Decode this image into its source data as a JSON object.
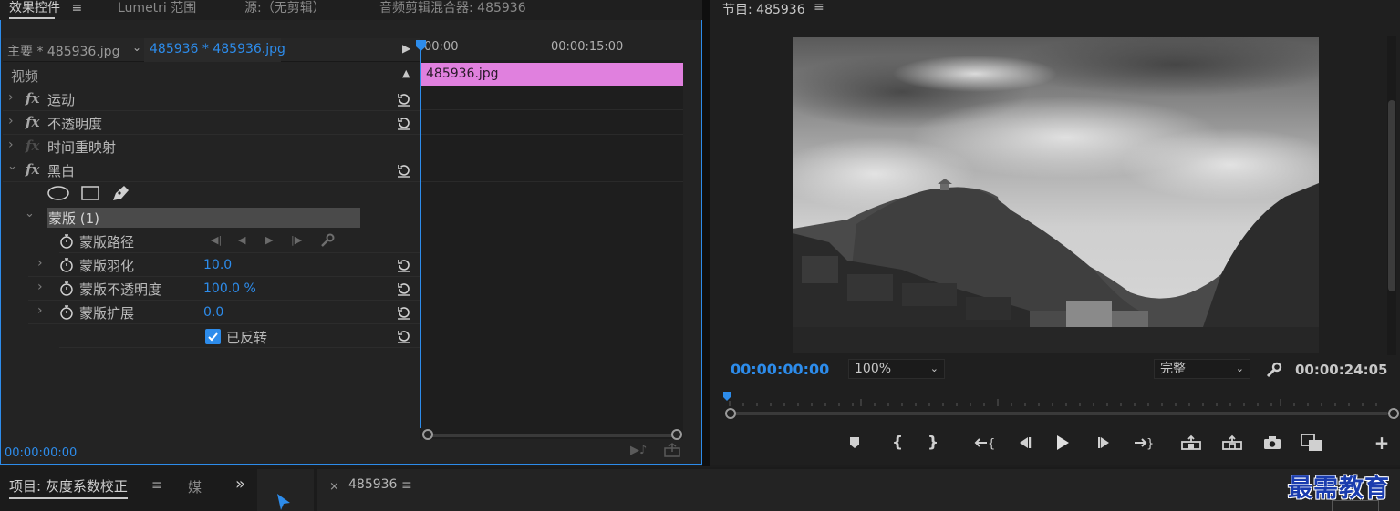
{
  "tabs_top": {
    "effect_controls": "效果控件",
    "lumetri": "Lumetri 范围",
    "source": "源:（无剪辑）",
    "audio_mixer": "音频剪辑混合器: 485936",
    "menu": "≡"
  },
  "effect_controls": {
    "master_clip": "主要 * 485936.jpg",
    "sequence_clip": "485936 * 485936.jpg",
    "section_video": "视频",
    "effects": [
      {
        "name": "运动",
        "enabled": true
      },
      {
        "name": "不透明度",
        "enabled": true
      },
      {
        "name": "时间重映射",
        "enabled": false
      },
      {
        "name": "黑白",
        "enabled": true
      }
    ],
    "mask": {
      "name": "蒙版 (1)",
      "path_label": "蒙版路径",
      "feather_label": "蒙版羽化",
      "feather_value": "10.0",
      "opacity_label": "蒙版不透明度",
      "opacity_value": "100.0 %",
      "expansion_label": "蒙版扩展",
      "expansion_value": "0.0",
      "inverted_label": "已反转",
      "inverted": true
    },
    "timeline": {
      "tick_start": "00:00",
      "tick_mid": "00:00:15:00",
      "clip_name": "485936.jpg"
    },
    "timecode": "00:00:00:00"
  },
  "program": {
    "title": "节目: 485936",
    "menu": "≡",
    "timecode_current": "00:00:00:00",
    "zoom": "100%",
    "quality": "完整",
    "timecode_duration": "00:00:24:05"
  },
  "bottom": {
    "project_tab": "项目: 灰度系数校正",
    "media_tab": "媒",
    "more": "»",
    "sequence_tab": "485936",
    "close": "×",
    "menu": "≡",
    "watermark": "最需教育"
  },
  "colors": {
    "accent": "#2d8ceb",
    "clip": "#e080de",
    "panel": "#232323"
  }
}
